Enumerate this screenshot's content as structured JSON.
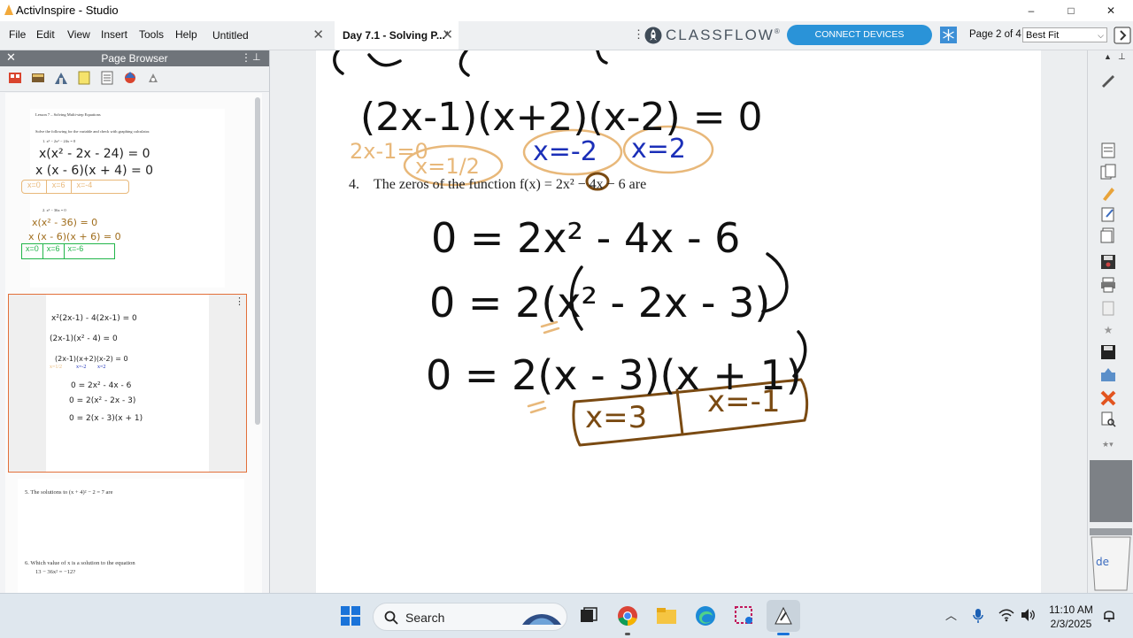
{
  "window": {
    "title": "ActivInspire - Studio",
    "controls": {
      "minimize": "–",
      "maximize": "□",
      "close": "✕"
    }
  },
  "menu": {
    "items": [
      "File",
      "Edit",
      "View",
      "Insert",
      "Tools",
      "Help"
    ]
  },
  "tabs": [
    {
      "label": "Untitled",
      "active": false
    },
    {
      "label": "Day 7.1 - Solving P...*",
      "active": true
    }
  ],
  "classflow": {
    "brand": "CLASSFLOW",
    "registered": "®",
    "connect_button": "CONNECT DEVICES"
  },
  "page_nav": {
    "page_count": "Page 2 of 4",
    "zoom": "Best Fit"
  },
  "page_browser": {
    "title": "Page Browser",
    "thumb1": {
      "heading": "Lesson 7 – Solving Multi-step Equations",
      "instruction": "Solve the following for the variable and check with graphing calculator.",
      "printed_eq1": "1.  x³ − 2x² − 24x = 0",
      "hand_lines": [
        "x(x² - 2x - 24) = 0",
        "x (x - 6)(x + 4) = 0"
      ],
      "answers1": [
        "x=0",
        "x=6",
        "x=-4"
      ],
      "printed_eq2": "2.  x³ − 36x = 0",
      "hand_lines2": [
        "x(x² - 36) = 0",
        "x (x - 6)(x + 6) = 0"
      ],
      "answers2": [
        "x=0",
        "x=6",
        "x=-6"
      ]
    },
    "thumb2": {
      "hand_lines": [
        "x²(2x-1) - 4(2x-1) = 0",
        "(2x-1)(x² - 4) = 0",
        "(2x-1)(x+2)(x-2) = 0",
        "0 = 2x² - 4x - 6",
        "0 = 2(x² - 2x - 3)",
        "0 = 2(x - 3)(x + 1)"
      ],
      "answers": [
        "x=1/2",
        "x=-2",
        "x=2"
      ]
    },
    "thumb3": {
      "q5": "5.    The solutions to (x + 4)² − 2 = 7 are",
      "q6": "6.    Which value of x is a solution to the equation",
      "q6b": "13 − 36x² = −12?"
    }
  },
  "page": {
    "question4": {
      "number": "4.",
      "text": "The zeros of the function f(x) = 2x² − 4x − 6 are"
    },
    "handwriting": {
      "top_factored": "(2x-1)(x+2)(x-2) = 0",
      "sol_half": "2x-1=0",
      "sol_half_result": "x=1/2",
      "sol_neg2": "x=-2",
      "sol_2": "x=2",
      "step1": "0 = 2x² - 4x - 6",
      "step2": "0 = 2(x² - 2x - 3)",
      "step3": "0 = 2(x - 3)(x + 1)",
      "answer_a": "x=3",
      "answer_b": "x=-1"
    },
    "colors": {
      "ink_black": "#111111",
      "ink_blue": "#1b2fb8",
      "ink_orange": "#e8b87a",
      "ink_brown": "#7a4a12",
      "ink_green": "#22b54a"
    }
  },
  "taskbar": {
    "search_label": "Search",
    "time": "11:10 AM",
    "date": "2/3/2025"
  }
}
